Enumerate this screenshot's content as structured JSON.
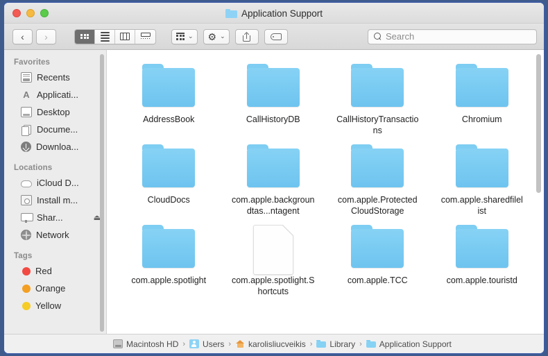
{
  "window": {
    "title": "Application Support",
    "traffic_lights": [
      "close",
      "minimize",
      "zoom"
    ]
  },
  "toolbar": {
    "back_label": "‹",
    "forward_label": "›",
    "view_modes": [
      {
        "name": "icon-view",
        "selected": true
      },
      {
        "name": "list-view",
        "selected": false
      },
      {
        "name": "column-view",
        "selected": false
      },
      {
        "name": "gallery-view",
        "selected": false
      }
    ],
    "group_by_label": "",
    "action_label": "",
    "share_label": "",
    "tags_label": "",
    "chevron": "⌄"
  },
  "search": {
    "placeholder": "Search",
    "value": ""
  },
  "sidebar": {
    "sections": [
      {
        "heading": "Favorites",
        "items": [
          {
            "label": "Recents",
            "icon": "recents-icon"
          },
          {
            "label": "Applicati...",
            "icon": "applications-icon"
          },
          {
            "label": "Desktop",
            "icon": "desktop-icon"
          },
          {
            "label": "Docume...",
            "icon": "documents-icon"
          },
          {
            "label": "Downloa...",
            "icon": "downloads-icon"
          }
        ]
      },
      {
        "heading": "Locations",
        "items": [
          {
            "label": "iCloud D...",
            "icon": "icloud-icon"
          },
          {
            "label": "Install m...",
            "icon": "disk-icon"
          },
          {
            "label": "Shar...",
            "icon": "display-icon",
            "eject": "⏏"
          },
          {
            "label": "Network",
            "icon": "globe-icon"
          }
        ]
      },
      {
        "heading": "Tags",
        "items": [
          {
            "label": "Red",
            "icon": "tag-dot-icon",
            "color": "#f24a42"
          },
          {
            "label": "Orange",
            "icon": "tag-dot-icon",
            "color": "#f4a024"
          },
          {
            "label": "Yellow",
            "icon": "tag-dot-icon",
            "color": "#f6cc26"
          }
        ]
      }
    ]
  },
  "content": {
    "items": [
      {
        "label": "AddressBook",
        "kind": "folder"
      },
      {
        "label": "CallHistoryDB",
        "kind": "folder"
      },
      {
        "label": "CallHistoryTransactions",
        "kind": "folder"
      },
      {
        "label": "Chromium",
        "kind": "folder"
      },
      {
        "label": "CloudDocs",
        "kind": "folder"
      },
      {
        "label": "com.apple.backgroundtas...ntagent",
        "kind": "folder"
      },
      {
        "label": "com.apple.ProtectedCloudStorage",
        "kind": "folder"
      },
      {
        "label": "com.apple.sharedfilelist",
        "kind": "folder"
      },
      {
        "label": "com.apple.spotlight",
        "kind": "folder"
      },
      {
        "label": "com.apple.spotlight.Shortcuts",
        "kind": "document"
      },
      {
        "label": "com.apple.TCC",
        "kind": "folder"
      },
      {
        "label": "com.apple.touristd",
        "kind": "folder"
      }
    ]
  },
  "pathbar": {
    "separator": "›",
    "crumbs": [
      {
        "label": "Macintosh HD",
        "icon": "hard-drive-icon"
      },
      {
        "label": "Users",
        "icon": "users-folder-icon"
      },
      {
        "label": "karolisliucveikis",
        "icon": "home-folder-icon"
      },
      {
        "label": "Library",
        "icon": "folder-icon"
      },
      {
        "label": "Application Support",
        "icon": "folder-icon"
      }
    ]
  }
}
